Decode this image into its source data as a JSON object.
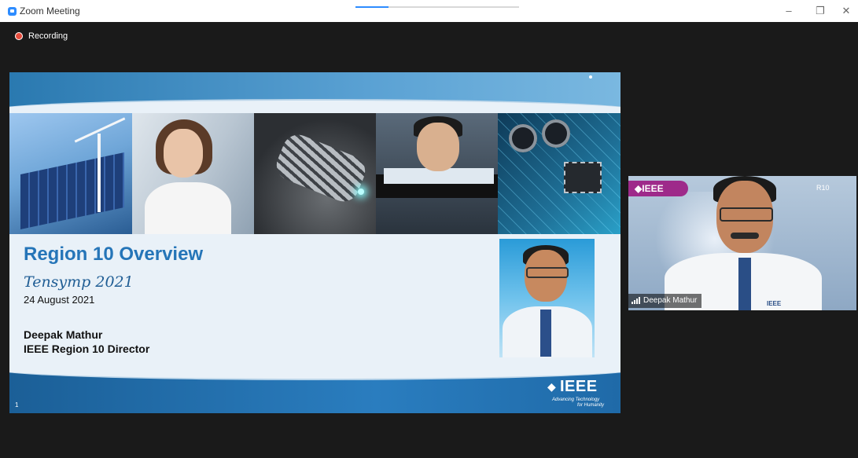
{
  "window": {
    "title": "Zoom Meeting",
    "minimize_glyph": "–",
    "restore_glyph": "❐",
    "close_glyph": "✕"
  },
  "recording": {
    "label": "Recording",
    "dot_color": "#e74c3c"
  },
  "slide": {
    "title": "Region 10 Overview",
    "event": "Tensymp 2021",
    "date": "24 August 2021",
    "presenter": "Deepak Mathur",
    "role": "IEEE Region 10 Director",
    "page_number": "1",
    "logo": {
      "word": "IEEE",
      "tagline_1": "Advancing Technology",
      "tagline_2": "for Humanity"
    },
    "photo_icons": [
      "solar-wind-photo",
      "scientist-photo",
      "robot-hand-photo",
      "engineer-photo",
      "circuit-board-photo"
    ]
  },
  "video": {
    "participant_name": "Deepak Mathur",
    "badge_text": "IEEE",
    "r10_text": "R10",
    "shirt_logo": "IEEE"
  },
  "colors": {
    "accent": "#2d8cff",
    "slide_title": "#2575b8",
    "ieee_badge": "#9e2a8a"
  }
}
